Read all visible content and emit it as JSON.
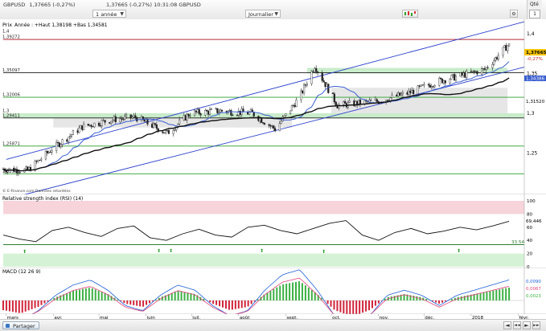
{
  "header": {
    "title": "GBPUSD",
    "price": "1,37665",
    "change": "(-0,27%)",
    "time": "10:31:08",
    "symbol_suffix": "GBPUSD",
    "period_select": "1 année",
    "interval_select": "Journalier",
    "qty_label": "Qté",
    "qty_value": "1"
  },
  "price_panel": {
    "label": "Prix",
    "info": "Année : +Haut 1,38198 +Bas 1,34581",
    "source": "© E-Finance.com Données retardées",
    "y_ticks": [
      "1,4",
      "1,35",
      "1,3",
      "1,25"
    ],
    "left_labels": [
      "1,4",
      "1,39272",
      "1,35097",
      "1,32006",
      "1,3",
      "1,29411",
      "1,25871",
      "1,22387"
    ],
    "right_labels": {
      "last": "1,37665",
      "change": "-0,27%",
      "ma_short": "1,34386",
      "ma_long": "1,31520"
    }
  },
  "rsi_panel": {
    "title": "Relative strength index (RSI) (14)",
    "y_ticks": [
      "100",
      "80",
      "60",
      "40",
      "20",
      "0"
    ],
    "value": "69,446",
    "threshold": "33.54"
  },
  "macd_panel": {
    "title": "MACD (12 26 9)",
    "values": [
      "0,0090",
      "0,0067",
      "0,0023"
    ]
  },
  "x_labels": [
    "mars",
    "avr.",
    "mai",
    "juin",
    "juil.",
    "août",
    "sept.",
    "oct.",
    "nov.",
    "déc.",
    "2018",
    "févr."
  ],
  "footer": {
    "share": "Partager",
    "nav": [
      "◄",
      "◄◄",
      "►",
      "►►"
    ]
  },
  "colors": {
    "bull": "#2ca02c",
    "bear": "#d32f2f",
    "channel": "#2b3fcc",
    "ma_blue": "#3a5fd0",
    "ma_black": "#111111",
    "zone": "#e6e6e6",
    "green_band": "#c9eccb",
    "rsi_top": "#f6d4d9",
    "rsi_bottom": "#d6f2d6"
  },
  "chart_data": [
    {
      "type": "candlestick",
      "title": "GBPUSD",
      "x_range": [
        "2017-02-27",
        "2018-02-05"
      ],
      "ylim": [
        1.2,
        1.41
      ],
      "series_close": [
        {
          "x": "2017-03-01",
          "y": 1.23
        },
        {
          "x": "2017-03-15",
          "y": 1.228
        },
        {
          "x": "2017-03-31",
          "y": 1.255
        },
        {
          "x": "2017-04-20",
          "y": 1.283
        },
        {
          "x": "2017-05-10",
          "y": 1.292
        },
        {
          "x": "2017-05-25",
          "y": 1.295
        },
        {
          "x": "2017-06-15",
          "y": 1.275
        },
        {
          "x": "2017-06-30",
          "y": 1.3
        },
        {
          "x": "2017-07-20",
          "y": 1.303
        },
        {
          "x": "2017-08-10",
          "y": 1.3
        },
        {
          "x": "2017-08-25",
          "y": 1.28
        },
        {
          "x": "2017-09-10",
          "y": 1.32
        },
        {
          "x": "2017-09-20",
          "y": 1.36
        },
        {
          "x": "2017-10-05",
          "y": 1.31
        },
        {
          "x": "2017-10-31",
          "y": 1.315
        },
        {
          "x": "2017-11-20",
          "y": 1.325
        },
        {
          "x": "2017-12-10",
          "y": 1.34
        },
        {
          "x": "2017-12-31",
          "y": 1.35
        },
        {
          "x": "2018-01-10",
          "y": 1.355
        },
        {
          "x": "2018-01-25",
          "y": 1.385
        }
      ],
      "horizontal_levels": [
        1.39272,
        1.35097,
        1.32006,
        1.29411,
        1.25871,
        1.22387
      ],
      "last": 1.37665
    },
    {
      "type": "line",
      "title": "Relative strength index (RSI) (14)",
      "ylim": [
        0,
        100
      ],
      "values": [
        48,
        42,
        38,
        55,
        60,
        52,
        46,
        58,
        62,
        44,
        40,
        50,
        57,
        48,
        45,
        60,
        63,
        55,
        50,
        58,
        66,
        70,
        48,
        40,
        52,
        58,
        50,
        54,
        60,
        56,
        62,
        69
      ]
    },
    {
      "type": "bar",
      "title": "MACD (12 26 9)",
      "values": [
        -0.003,
        -0.004,
        -0.002,
        0.001,
        0.003,
        0.004,
        0.002,
        -0.001,
        -0.002,
        0.001,
        0.003,
        0.002,
        -0.001,
        -0.003,
        -0.002,
        0.002,
        0.005,
        0.006,
        0.002,
        -0.003,
        -0.005,
        -0.003,
        0.001,
        0.002,
        0.001,
        -0.001,
        0.001,
        0.002,
        0.003,
        0.004
      ]
    }
  ]
}
